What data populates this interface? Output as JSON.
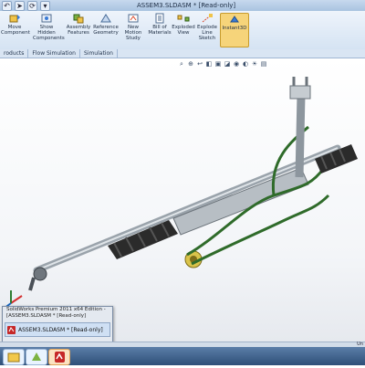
{
  "window": {
    "title": "ASSEM3.SLDASM * [Read-only]"
  },
  "quick_access": {
    "icons": [
      "undo-icon",
      "select-arrow-icon",
      "rebuild-icon",
      "options-icon"
    ]
  },
  "ribbon": {
    "buttons": [
      {
        "key": "move",
        "label": "Move\nComponent"
      },
      {
        "key": "hidden",
        "label": "Show\nHidden\nComponents"
      },
      {
        "key": "assembly",
        "label": "Assembly\nFeatures"
      },
      {
        "key": "reference",
        "label": "Reference\nGeometry"
      },
      {
        "key": "motion",
        "label": "New\nMotion\nStudy"
      },
      {
        "key": "bom",
        "label": "Bill of\nMaterials"
      },
      {
        "key": "exploded",
        "label": "Exploded\nView"
      },
      {
        "key": "sketch",
        "label": "Explode\nLine\nSketch"
      },
      {
        "key": "instant3d",
        "label": "Instant3D"
      }
    ],
    "active": "Instant3D"
  },
  "tabs": [
    "roducts",
    "Flow Simulation",
    "Simulation"
  ],
  "taskbar_popup": {
    "line1": "SolidWorks Premium 2011 x64 Edition -",
    "line2": "[ASSEM3.SLDASM * [Read-only]",
    "entry": "ASSEM3.SLDASM * [Read-only]"
  },
  "status": {
    "right": "Un"
  },
  "colors": {
    "accent": "#f6d47a",
    "ribbon": "#dbe7f5",
    "taskbar": "#3a5f8c",
    "part_green": "#2f6b2a"
  }
}
